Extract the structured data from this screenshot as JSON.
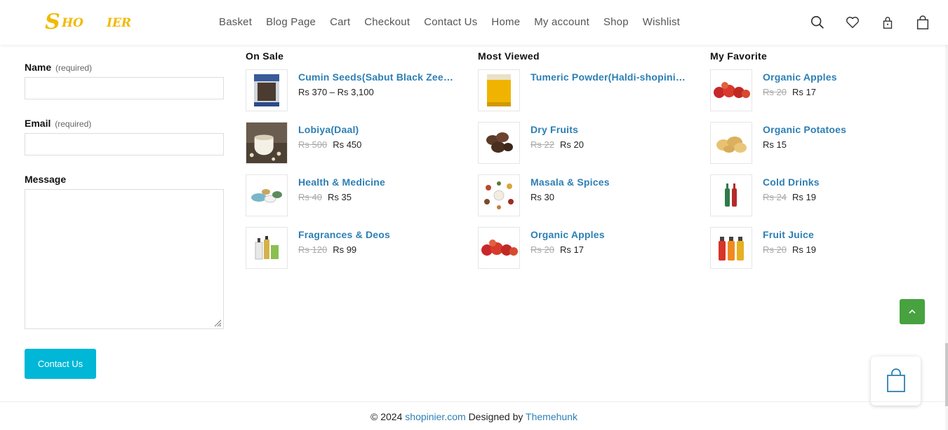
{
  "header": {
    "logo_big": "S",
    "logo_part1": "HO",
    "logo_part2": "IER",
    "nav": [
      "Basket",
      "Blog Page",
      "Cart",
      "Checkout",
      "Contact Us",
      "Home",
      "My account",
      "Shop",
      "Wishlist"
    ],
    "icons": [
      "search-icon",
      "heart-icon",
      "lock-icon",
      "bag-icon"
    ]
  },
  "form": {
    "name_label": "Name",
    "name_req": "(required)",
    "email_label": "Email",
    "email_req": "(required)",
    "message_label": "Message",
    "submit_label": "Contact Us",
    "name_value": "",
    "email_value": "",
    "message_value": ""
  },
  "columns": [
    {
      "title": "On Sale",
      "products": [
        {
          "name": "Cumin Seeds(Sabut Black Zeera-...",
          "old": "",
          "price": "Rs 370 – Rs 3,100",
          "image": "cumin-pack"
        },
        {
          "name": "Lobiya(Daal)",
          "old": "Rs 500",
          "price": "Rs 450",
          "image": "beans-cup"
        },
        {
          "name": "Health & Medicine",
          "old": "Rs 40",
          "price": "Rs 35",
          "image": "pills"
        },
        {
          "name": "Fragrances & Deos",
          "old": "Rs 120",
          "price": "Rs 99",
          "image": "bottles"
        }
      ]
    },
    {
      "title": "Most Viewed",
      "products": [
        {
          "name": "Tumeric Powder(Haldi-shopinier...",
          "old": "",
          "price": "",
          "image": "turmeric-pack"
        },
        {
          "name": "Dry Fruits",
          "old": "Rs 22",
          "price": "Rs 20",
          "image": "dry-fruits"
        },
        {
          "name": "Masala & Spices",
          "old": "",
          "price": "Rs 30",
          "image": "spices"
        },
        {
          "name": "Organic Apples",
          "old": "Rs 20",
          "price": "Rs 17",
          "image": "apples"
        }
      ]
    },
    {
      "title": "My Favorite",
      "products": [
        {
          "name": "Organic Apples",
          "old": "Rs 20",
          "price": "Rs 17",
          "image": "apples"
        },
        {
          "name": "Organic Potatoes",
          "old": "",
          "price": "Rs 15",
          "image": "potatoes"
        },
        {
          "name": "Cold Drinks",
          "old": "Rs 24",
          "price": "Rs 19",
          "image": "cold-drinks"
        },
        {
          "name": "Fruit Juice",
          "old": "Rs 20",
          "price": "Rs 19",
          "image": "juices"
        }
      ]
    }
  ],
  "footer": {
    "copy": "© 2024",
    "site": "shopinier.com",
    "designed_by": "Designed by",
    "brand": "Themehunk"
  },
  "colors": {
    "accent": "#00b7d7",
    "link": "#2d7fb4",
    "to_top": "#47a23f",
    "logo": "#f2b900"
  }
}
